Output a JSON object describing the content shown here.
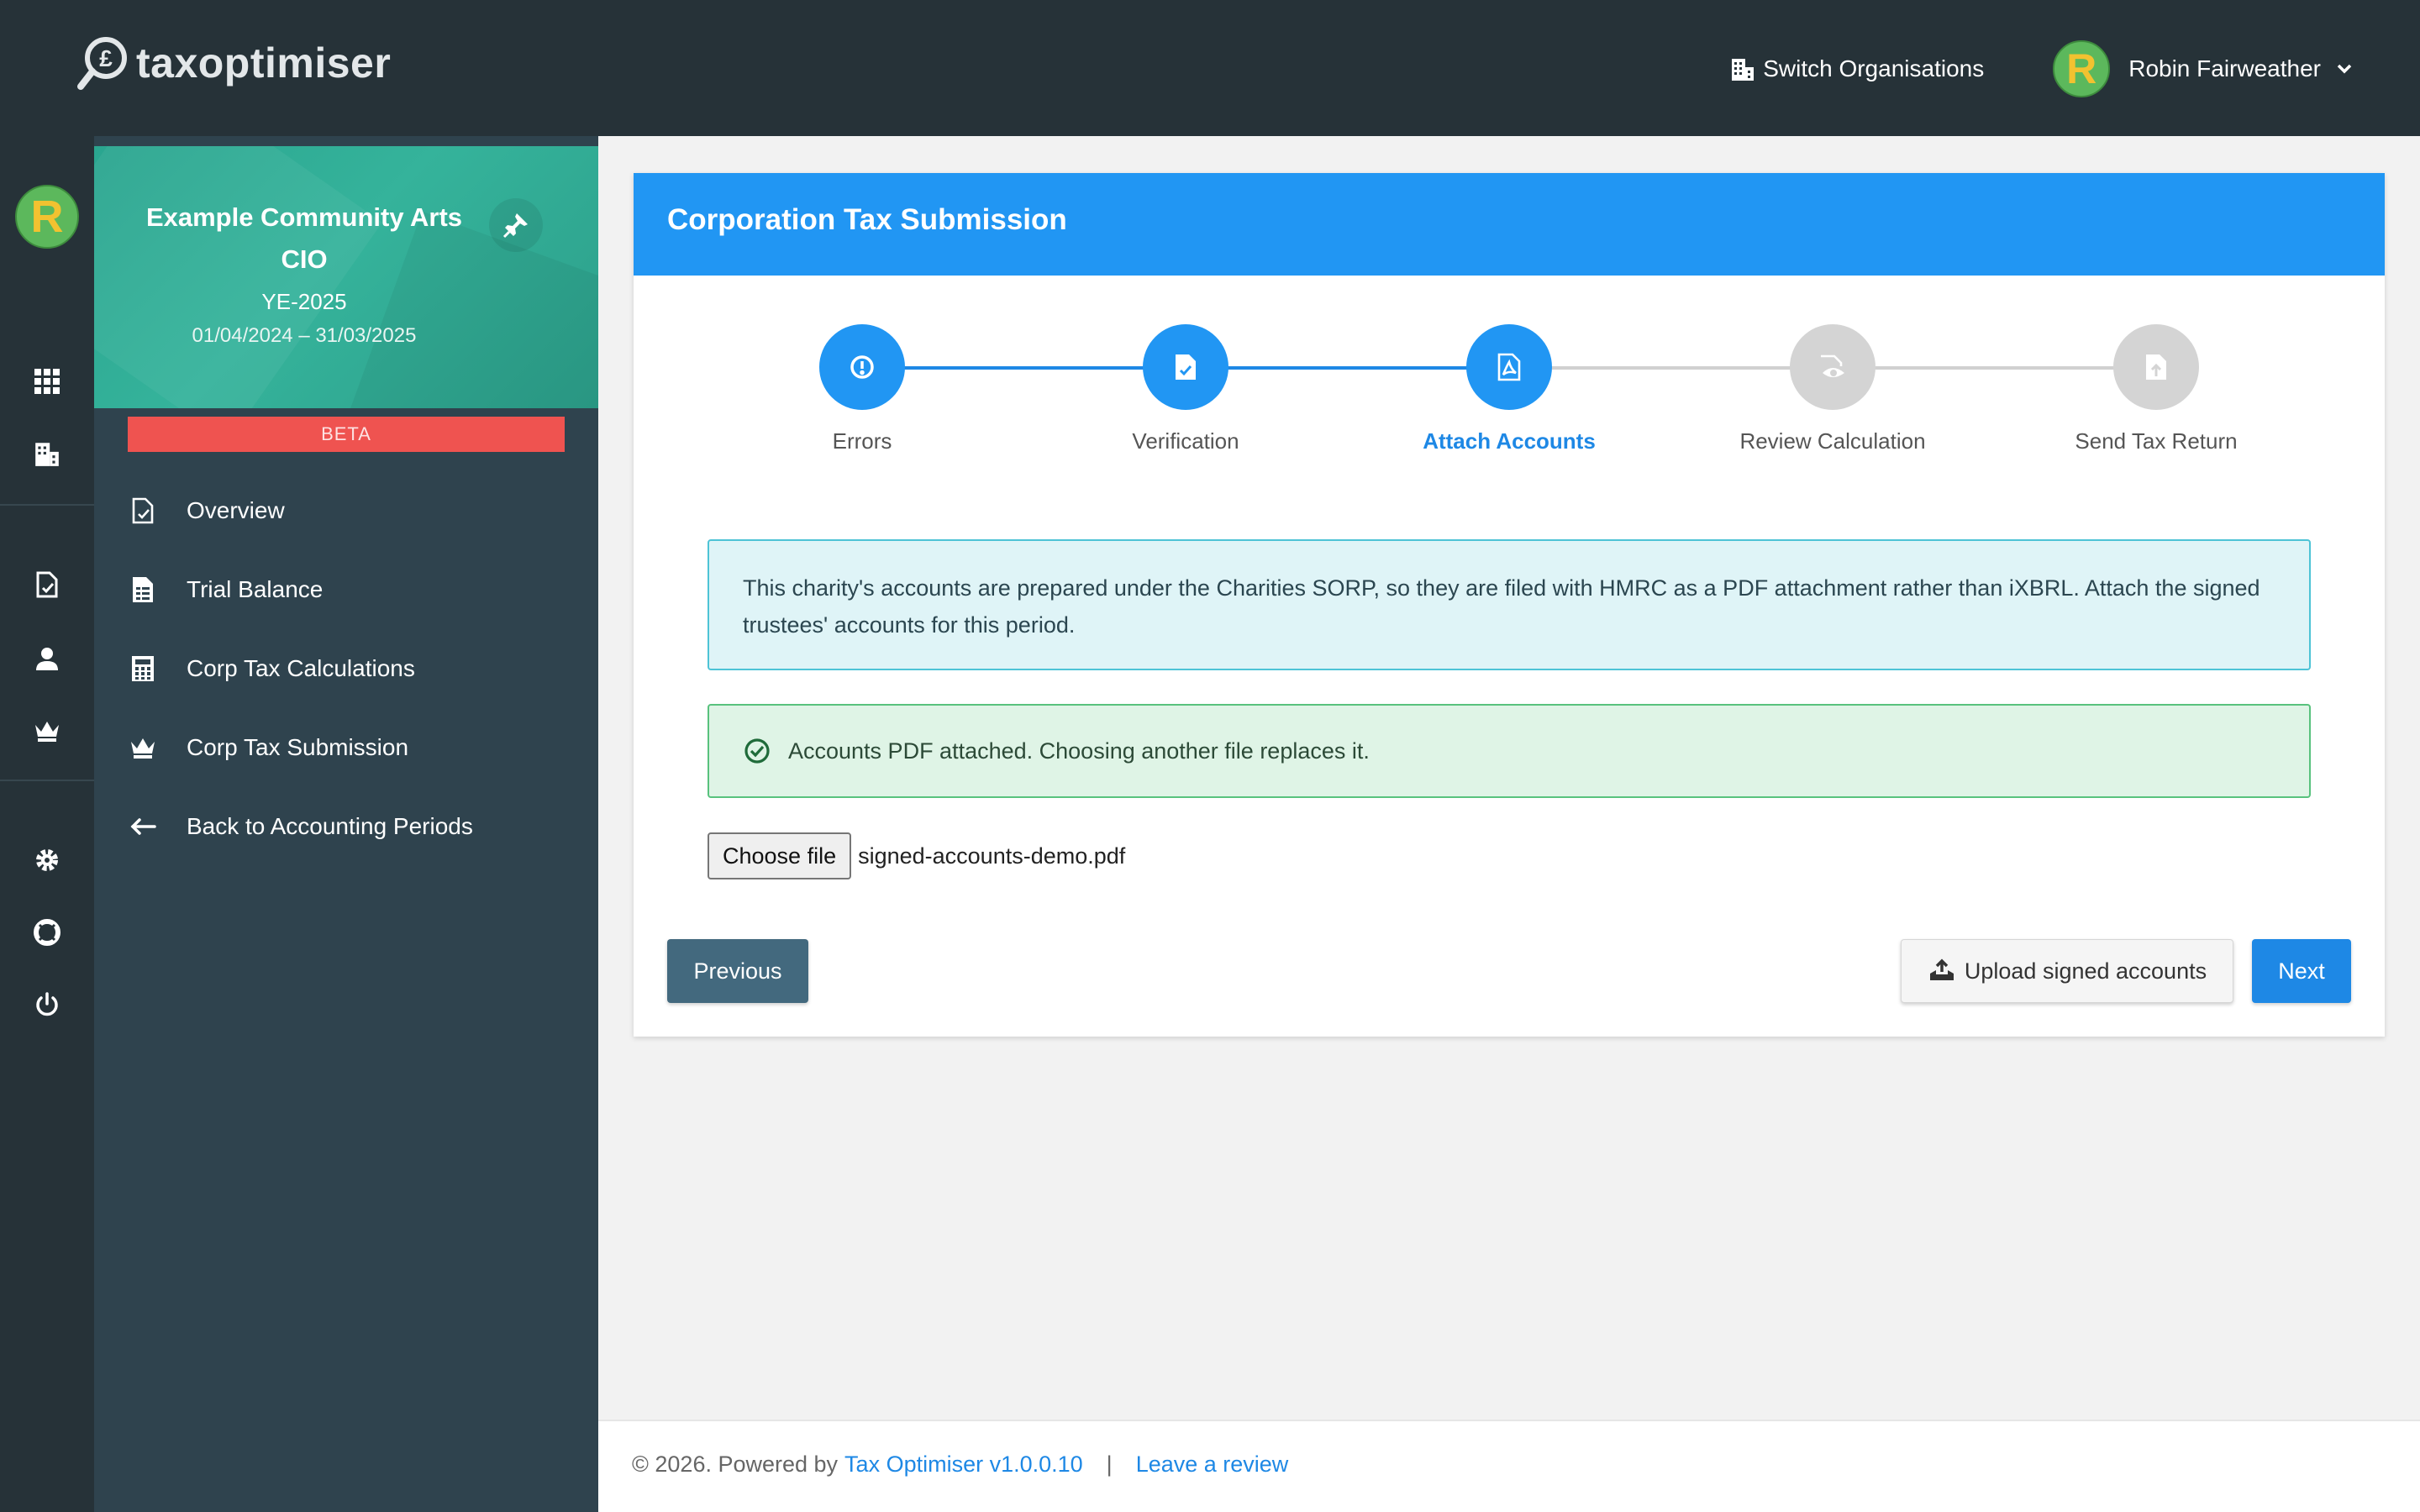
{
  "app": {
    "logo_text": "taxoptimiser"
  },
  "topbar": {
    "switch_org_label": "Switch Organisations",
    "user_initial": "R",
    "user_name": "Robin Fairweather"
  },
  "rail": {
    "avatar_initial": "R"
  },
  "sidebar": {
    "org_name": "Example Community Arts CIO",
    "year_label": "YE-2025",
    "period": "01/04/2024 – 31/03/2025",
    "beta_label": "BETA",
    "items": [
      {
        "label": "Overview",
        "icon": "document-check-icon"
      },
      {
        "label": "Trial Balance",
        "icon": "spreadsheet-icon"
      },
      {
        "label": "Corp Tax Calculations",
        "icon": "calculator-icon"
      },
      {
        "label": "Corp Tax Submission",
        "icon": "crown-icon"
      },
      {
        "label": "Back to Accounting Periods",
        "icon": "arrow-left-icon"
      }
    ]
  },
  "main": {
    "title": "Corporation Tax Submission",
    "steps": [
      {
        "label": "Errors",
        "state": "done",
        "icon": "alert-icon"
      },
      {
        "label": "Verification",
        "state": "done",
        "icon": "file-check-icon"
      },
      {
        "label": "Attach Accounts",
        "state": "active",
        "icon": "pdf-icon"
      },
      {
        "label": "Review Calculation",
        "state": "todo",
        "icon": "eye-icon"
      },
      {
        "label": "Send Tax Return",
        "state": "todo",
        "icon": "file-upload-icon"
      }
    ],
    "info_message": "This charity's accounts are prepared under the Charities SORP, so they are filed with HMRC as a PDF attachment rather than iXBRL. Attach the signed trustees' accounts for this period.",
    "success_message": "Accounts PDF attached. Choosing another file replaces it.",
    "file_input": {
      "button_label": "Choose file",
      "file_name": "signed-accounts-demo.pdf"
    },
    "buttons": {
      "previous": "Previous",
      "upload": "Upload signed accounts",
      "next": "Next"
    }
  },
  "footer": {
    "copyright": "© 2026. Powered by",
    "product_link": "Tax Optimiser v1.0.0.10",
    "separator": "|",
    "review_link": "Leave a review"
  },
  "colors": {
    "topbar": "#263238",
    "sidebar": "#2f434e",
    "primary": "#2196f3",
    "org_card": "#2aa58f",
    "beta": "#ef5350"
  }
}
